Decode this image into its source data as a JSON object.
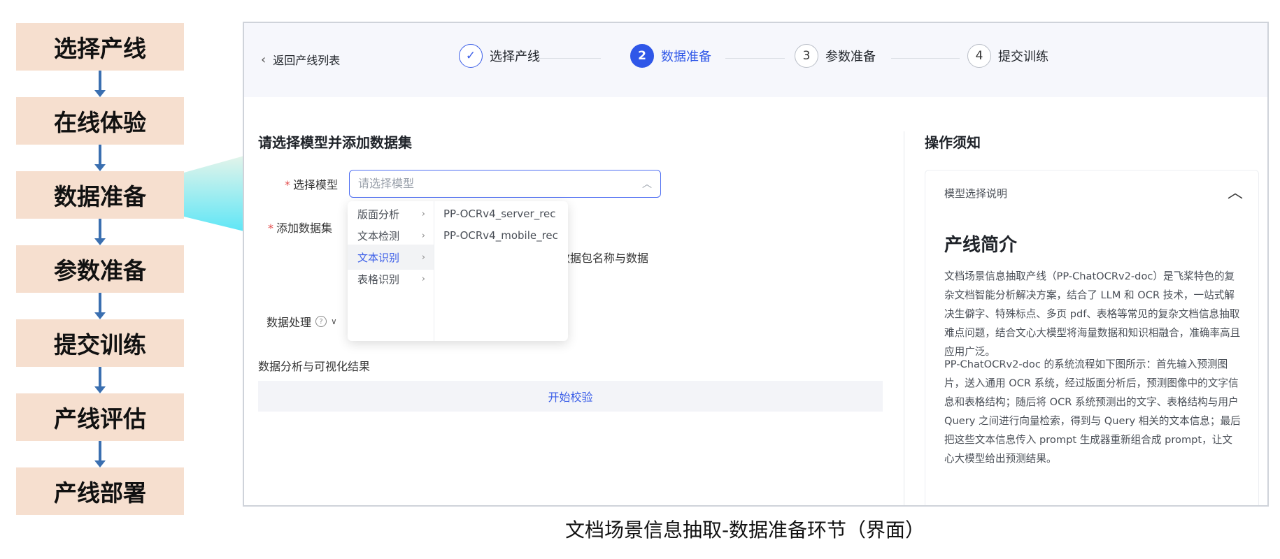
{
  "flow": {
    "steps": [
      "选择产线",
      "在线体验",
      "数据准备",
      "参数准备",
      "提交训练",
      "产线评估",
      "产线部署"
    ],
    "step_color": "#f6dfcf",
    "arrow_color": "#3a6fb0",
    "highlight_step": "数据准备"
  },
  "header": {
    "back_label": "返回产线列表",
    "steps": [
      {
        "label": "选择产线",
        "state": "done",
        "marker": "✓"
      },
      {
        "label": "数据准备",
        "state": "active",
        "marker": "2"
      },
      {
        "label": "参数准备",
        "state": "todo",
        "marker": "3"
      },
      {
        "label": "提交训练",
        "state": "todo",
        "marker": "4"
      }
    ]
  },
  "form": {
    "title": "请选择模型并添加数据集",
    "model_label": "选择模型",
    "model_placeholder": "请选择模型",
    "dataset_label": "添加数据集",
    "dataset_hint_partial": "数据包名称与数据",
    "processing_label": "数据处理",
    "required_mark": "*"
  },
  "dropdown": {
    "categories": [
      {
        "label": "版面分析",
        "active": false
      },
      {
        "label": "文本检测",
        "active": false
      },
      {
        "label": "文本识别",
        "active": true
      },
      {
        "label": "表格识别",
        "active": false
      }
    ],
    "models": [
      "PP-OCRv4_server_rec",
      "PP-OCRv4_mobile_rec"
    ]
  },
  "analysis": {
    "title": "数据分析与可视化结果",
    "verify_button": "开始校验"
  },
  "sidebar": {
    "title": "操作须知",
    "card_header": "模型选择说明",
    "card_title": "产线简介",
    "paragraph1": "文档场景信息抽取产线（PP-ChatOCRv2-doc）是飞桨特色的复杂文档智能分析解决方案，结合了 LLM 和 OCR 技术，一站式解决生僻字、特殊标点、多页 pdf、表格等常见的复杂文档信息抽取难点问题，结合文心大模型将海量数据和知识相融合，准确率高且应用广泛。",
    "paragraph2": "PP-ChatOCRv2-doc 的系统流程如下图所示：首先输入预测图片，送入通用 OCR 系统，经过版面分析后，预测图像中的文字信息和表格结构；随后将 OCR 系统预测出的文字、表格结构与用户 Query 之间进行向量检索，得到与 Query 相关的文本信息；最后把这些文本信息传入 prompt 生成器重新组合成 prompt，让文心大模型给出预测结果。"
  },
  "caption": "文档场景信息抽取-数据准备环节（界面）",
  "colors": {
    "accent": "#2f57e8",
    "required": "#e34d4d",
    "connector_gradient_start": "#d9f3e4",
    "connector_gradient_end": "#5fe6f6"
  }
}
